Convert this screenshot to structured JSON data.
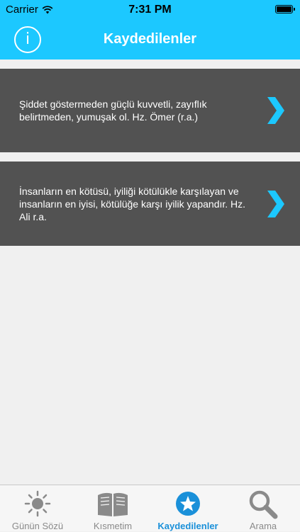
{
  "status": {
    "carrier": "Carrier",
    "time": "7:31 PM"
  },
  "nav": {
    "title": "Kaydedilenler",
    "info_glyph": "i"
  },
  "cards": [
    {
      "text": "Şiddet göstermeden güçlü kuvvetli, zayıflık belirtmeden, yumuşak ol. Hz. Ömer (r.a.)"
    },
    {
      "text": "İnsanların en kötüsü, iyiliği kötülükle karşılayan ve insanların en iyisi, kötülüğe karşı iyilik yapandır. Hz. Ali r.a."
    }
  ],
  "tabs": [
    {
      "label": "Günün Sözü",
      "icon": "sun-icon"
    },
    {
      "label": "Kısmetim",
      "icon": "book-icon"
    },
    {
      "label": "Kaydedilenler",
      "icon": "star-icon"
    },
    {
      "label": "Arama",
      "icon": "search-icon"
    }
  ],
  "colors": {
    "accent": "#1cc8ff",
    "card": "#525252",
    "tab_active": "#1a90d9",
    "tab_inactive": "#8a8a8a"
  }
}
